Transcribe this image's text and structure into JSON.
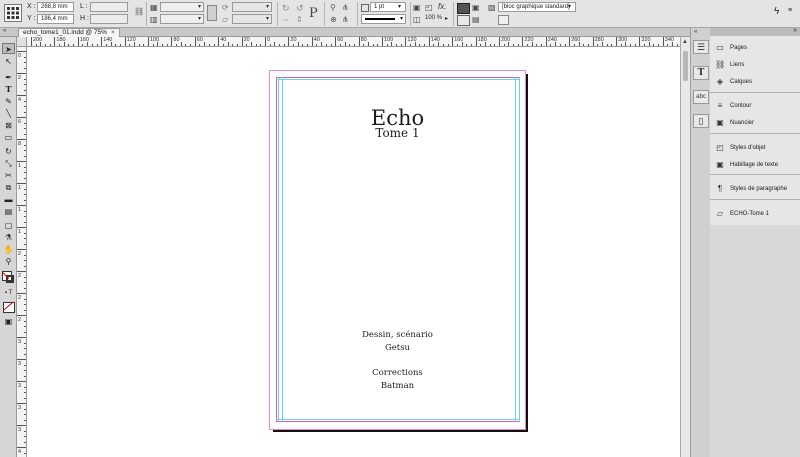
{
  "control_bar": {
    "x_label": "X :",
    "y_label": "Y :",
    "w_label": "L :",
    "h_label": "H :",
    "x_value": "268,8 mm",
    "y_value": "186,4 mm",
    "stroke_weight": "1 pt",
    "opacity": "100 %",
    "object_style": "[bloc graphique standard]"
  },
  "document_tab": {
    "title": "echo_tome1_01.indd @ 75%",
    "close": "×"
  },
  "ruler_h_labels": [
    "200",
    "180",
    "160",
    "140",
    "120",
    "100",
    "80",
    "60",
    "40",
    "20",
    "0",
    "20",
    "40",
    "60",
    "80",
    "100",
    "120",
    "140",
    "160",
    "180",
    "200",
    "220",
    "240",
    "260",
    "280",
    "300",
    "320",
    "340",
    "360",
    "380",
    "400"
  ],
  "ruler_v_labels": [
    "0",
    "2",
    "4",
    "6",
    "8",
    "1",
    "1",
    "1",
    "1",
    "2",
    "2",
    "2",
    "2",
    "3",
    "3",
    "3",
    "3",
    "3",
    "4"
  ],
  "page": {
    "title": "Echo",
    "subtitle": "Tome 1",
    "credit1_role": "Dessin, scénario",
    "credit1_name": "Getsu",
    "credit2_role": "Corrections",
    "credit2_name": "Batman"
  },
  "panels": [
    {
      "label": "Pages",
      "icon": "pages-icon"
    },
    {
      "label": "Liens",
      "icon": "links-icon"
    },
    {
      "label": "Calques",
      "icon": "layers-icon"
    },
    {
      "label": "Contour",
      "icon": "stroke-icon"
    },
    {
      "label": "Nuancier",
      "icon": "swatches-icon"
    },
    {
      "label": "Styles d'objet",
      "icon": "object-styles-icon"
    },
    {
      "label": "Habillage de texte",
      "icon": "text-wrap-icon"
    },
    {
      "label": "Styles de paragraphe",
      "icon": "paragraph-styles-icon"
    },
    {
      "label": "ECHO-Tome 1",
      "icon": "book-icon"
    }
  ],
  "colors": {
    "margin_guide": "#d65aa8",
    "column_guide": "#66d5f0",
    "page_border": "#e58ac8"
  }
}
